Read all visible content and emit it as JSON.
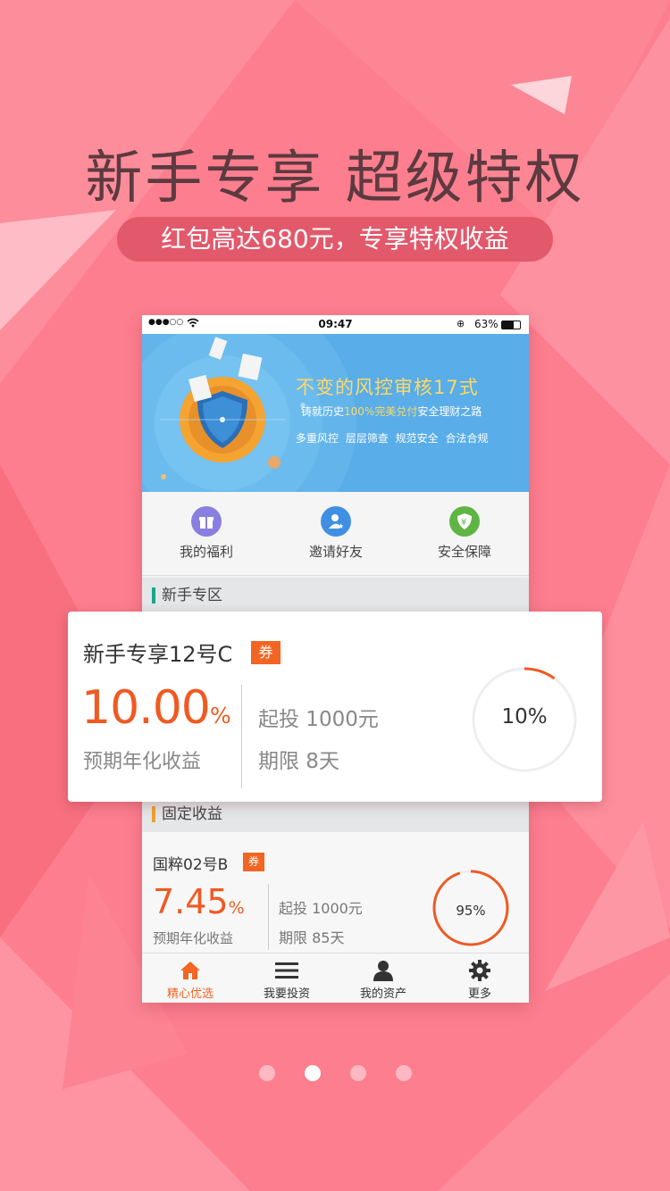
{
  "headline": "新手专享 超级特权",
  "subline": "红包高达680元，专享特权收益",
  "colors": {
    "accent": "#f26522",
    "background": "#fd7e8e",
    "pill": "#e2596b",
    "banner": "#59ade8"
  },
  "statusbar": {
    "signal": "●●●○○",
    "wifi": "wifi-icon",
    "time": "09:47",
    "battery_pct": "63%"
  },
  "banner": {
    "title": "不变的风控审核",
    "title_highlight": "17式",
    "sub_prefix": "铸就历史",
    "sub_highlight": "100%完美兑付",
    "sub_suffix": "安全理财之路",
    "tags": "多重风控 层层筛查 规范安全 合法合规"
  },
  "quick": [
    {
      "label": "我的福利",
      "icon": "gift-icon",
      "color": "#8a7ee0",
      "glyph": "❒"
    },
    {
      "label": "邀请好友",
      "icon": "invite-user-icon",
      "color": "#3f90e3",
      "glyph": "★"
    },
    {
      "label": "安全保障",
      "icon": "shield-icon",
      "color": "#5fb543",
      "glyph": "¥"
    }
  ],
  "sections": {
    "new": "新手专区",
    "fixed": "固定收益"
  },
  "featured": {
    "name": "新手专享12号C",
    "badge": "券",
    "rate": "10.00",
    "rate_unit": "%",
    "rate_label": "预期年化收益",
    "min_invest": "起投 1000元",
    "term": "期限 8天",
    "progress_label": "10%",
    "progress": 0.1
  },
  "product": {
    "name": "国粹02号B",
    "badge": "券",
    "rate": "7.45",
    "rate_unit": "%",
    "rate_label": "预期年化收益",
    "min_invest": "起投 1000元",
    "term": "期限 85天",
    "progress_label": "95%",
    "progress": 0.95
  },
  "tabs": [
    {
      "label": "精心优选",
      "icon": "home-icon",
      "active": true
    },
    {
      "label": "我要投资",
      "icon": "list-icon",
      "active": false
    },
    {
      "label": "我的资产",
      "icon": "user-icon",
      "active": false
    },
    {
      "label": "更多",
      "icon": "gear-icon",
      "active": false
    }
  ],
  "pager": {
    "count": 4,
    "active": 1
  }
}
